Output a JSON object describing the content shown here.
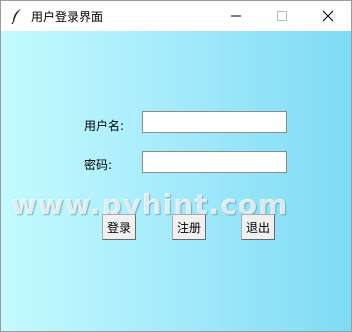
{
  "window": {
    "title": "用户登录界面",
    "icon": "feather-icon",
    "controls": [
      "minimize-icon",
      "maximize-icon",
      "close-icon"
    ]
  },
  "form": {
    "username_label": "用户名:",
    "username_value": "",
    "password_label": "密码:",
    "password_value": ""
  },
  "buttons": {
    "login": "登录",
    "register": "注册",
    "exit": "退出"
  },
  "watermark": "www.pyhint.com",
  "colors": {
    "gradient_left": "#c3fbfe",
    "gradient_right": "#7fdbf5",
    "button_face": "#f0f0f0"
  }
}
